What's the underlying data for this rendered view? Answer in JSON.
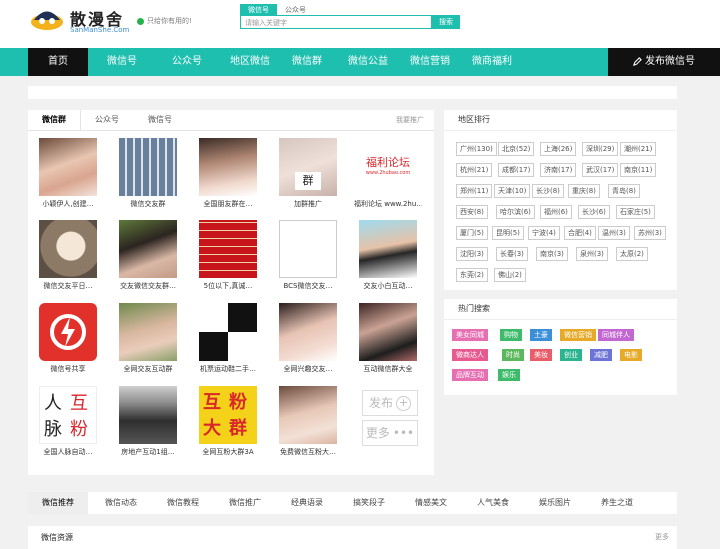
{
  "header": {
    "site_name": "散漫舍",
    "site_url": "SanManShe.Com",
    "slogan": "只给你有用的!",
    "search_tabs": [
      "微信号",
      "公众号"
    ],
    "search_placeholder": "请输入关键字",
    "search_button": "搜索"
  },
  "nav": {
    "items": [
      "首页",
      "微信号",
      "公众号",
      "地区微信",
      "微信群",
      "微信公益",
      "微信营销",
      "微商福利"
    ],
    "post_button": "发布微信号"
  },
  "left": {
    "tabs": [
      "微信群",
      "公众号",
      "微信号"
    ],
    "more": "我要推广",
    "cards": [
      "小颖伊人,创建…",
      "微信交友群",
      "全国朋友群在…",
      "加群推广",
      "福利论坛 www.2hu…",
      "微信交友平日…",
      "交友微信交友群…",
      "5位以下,真诚…",
      "BCS微信交友…",
      "交友小白互动…",
      "微信号共享",
      "全网交友互动群",
      "机票运动鞋二手…",
      "全网兴趣交友…",
      "互动微信群大全",
      "全国人脉自动…",
      "房地产互动1组…",
      "全网互粉大群3A",
      "免费微信互粉大…"
    ],
    "fuli_title": "福利论坛",
    "fuli_url": "www.2hubao.com",
    "group_badge": "群",
    "renmai": [
      "人",
      "脉",
      "互",
      "粉"
    ],
    "hufen": [
      "互",
      "粉",
      "大",
      "群"
    ],
    "post_label": "发布",
    "more_label": "更多",
    "post_icon": "plus-circle-icon",
    "more_icon": "ellipsis-icon"
  },
  "cities": {
    "title": "地区排行",
    "items": [
      "广州(130)",
      "北京(52)",
      "上海(26)",
      "深圳(29)",
      "潮州(21)",
      "杭州(21)",
      "成都(17)",
      "济南(17)",
      "武汉(17)",
      "南京(11)",
      "郑州(11)",
      "天津(10)",
      "长沙(8)",
      "重庆(8)",
      "青岛(8)",
      "西安(8)",
      "哈尔滨(6)",
      "福州(6)",
      "长沙(6)",
      "石家庄(5)",
      "厦门(5)",
      "昆明(5)",
      "宁波(4)",
      "合肥(4)",
      "温州(3)",
      "苏州(3)",
      "沈阳(3)",
      "长春(3)",
      "南京(3)",
      "泉州(3)",
      "太原(2)",
      "东莞(2)",
      "佛山(2)"
    ]
  },
  "hot": {
    "title": "热门搜索",
    "tags": [
      {
        "label": "美女同城",
        "color": "#e66fb2"
      },
      {
        "label": "购物",
        "color": "#3dbb6a"
      },
      {
        "label": "土豪",
        "color": "#3b8fd8"
      },
      {
        "label": "微信营销",
        "color": "#e6a928"
      },
      {
        "label": "同城伴人",
        "color": "#c266d1"
      },
      {
        "label": "微商达人",
        "color": "#e65a90"
      },
      {
        "label": "时尚",
        "color": "#5cb85c"
      },
      {
        "label": "美妆",
        "color": "#e85d6a"
      },
      {
        "label": "创业",
        "color": "#2bb48f"
      },
      {
        "label": "减肥",
        "color": "#6d73d6"
      },
      {
        "label": "电影",
        "color": "#e6a928"
      },
      {
        "label": "品牌互动",
        "color": "#e66fb2"
      },
      {
        "label": "娱乐",
        "color": "#3dbb6a"
      }
    ]
  },
  "bottom": {
    "tabs": [
      "微信推荐",
      "微信动态",
      "微信教程",
      "微信推广",
      "经典语录",
      "搞笑段子",
      "情感美文",
      "人气美食",
      "娱乐图片",
      "养生之道"
    ],
    "box_title": "微信资源",
    "box_more": "更多"
  }
}
